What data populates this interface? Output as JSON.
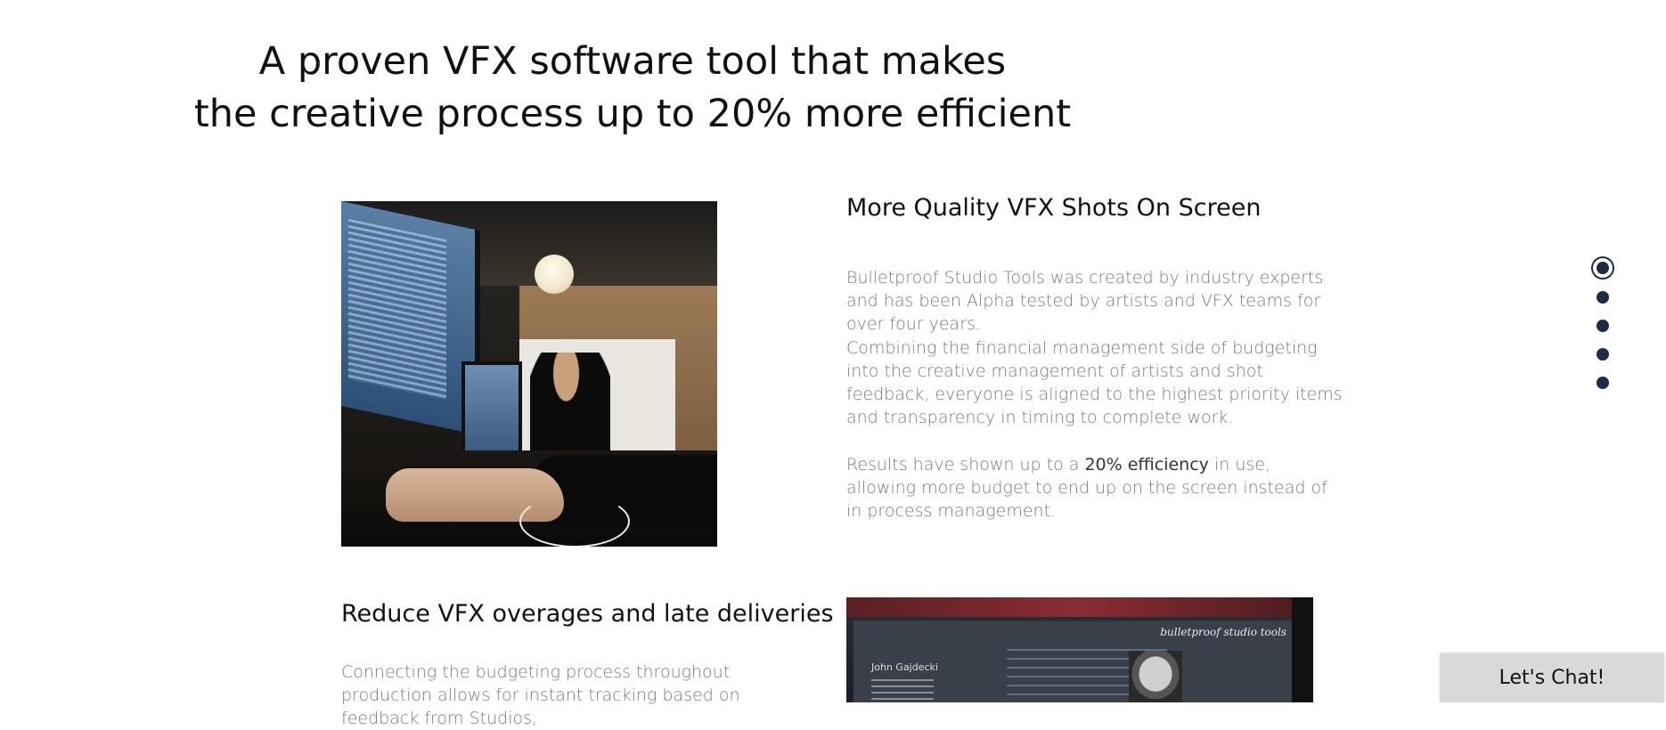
{
  "headline": {
    "line1": "A proven VFX software tool that makes",
    "line2": "the creative process up to 20% more efficient"
  },
  "section1": {
    "heading": "More Quality VFX Shots On Screen",
    "para1": "Bulletproof Studio Tools was created by industry experts and has been Alpha tested by artists and VFX teams for over four years.",
    "para2": "Combining the financial management side of budgeting into the creative management of artists and shot feedback, everyone is aligned to the highest priority items and transparency in timing to complete work.",
    "para3_before": "Results have shown up to a ",
    "para3_bold": "20% efficiency",
    "para3_after": " in use, allowing more budget to end up on the screen instead of in process management."
  },
  "section2": {
    "heading": "Reduce VFX overages and late deliveries",
    "para1": "Connecting the budgeting process throughout production allows for instant tracking based on feedback from Studios,"
  },
  "screenshot2": {
    "logo_text": "bulletproof studio tools",
    "user_name": "John Gajdecki"
  },
  "nav_dots": {
    "count": 5,
    "active_index": 0
  },
  "chat": {
    "label": "Let's Chat!"
  }
}
